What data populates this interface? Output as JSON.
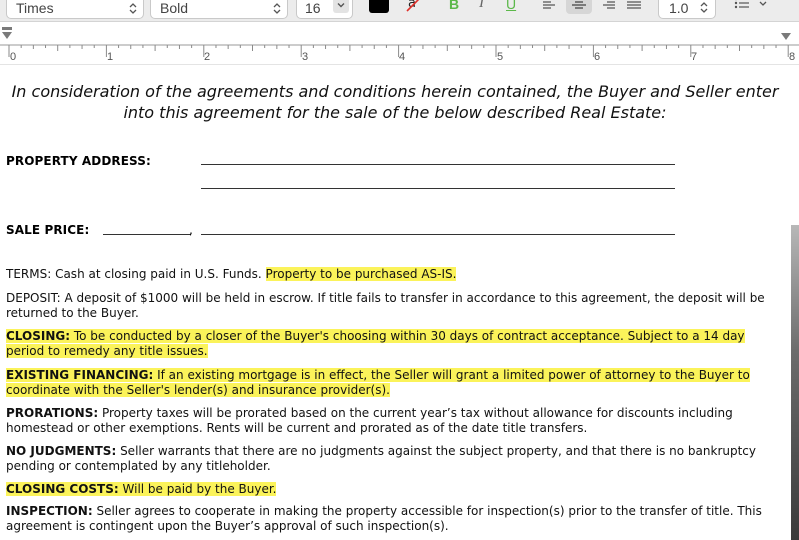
{
  "toolbar": {
    "font_family": "Times",
    "font_weight": "Bold",
    "font_size": "16",
    "text_color": "#000000",
    "bold_glyph": "B",
    "italic_glyph": "I",
    "underline_glyph": "U",
    "line_spacing": "1.0"
  },
  "ruler": {
    "numbers": [
      "0",
      "1",
      "2",
      "3",
      "4",
      "5",
      "6",
      "7",
      "8"
    ]
  },
  "document": {
    "intro": "In consideration of the agreements and conditions herein contained, the Buyer and Seller enter into this agreement for the sale of the below described Real Estate:",
    "property_address_label": "PROPERTY ADDRESS:",
    "sale_price_label": "SALE PRICE:",
    "sale_price_comma": ",",
    "terms": {
      "text": "TERMS: Cash at closing paid in U.S. Funds. ",
      "highlight": "Property to be purchased AS-IS."
    },
    "deposit": "DEPOSIT: A deposit of $1000 will be held in escrow. If title fails to transfer in accordance to this agreement, the deposit will be returned to the Buyer.",
    "closing": {
      "heading": "CLOSING:",
      "text": " To be conducted by a closer of the Buyer's choosing within 30 days of contract acceptance. Subject to a 14 day period to remedy any title issues."
    },
    "existing_financing": {
      "heading": "EXISTING FINANCING:",
      "text": " If an existing mortgage is in effect, the Seller will grant a limited power of attorney to the Buyer to coordinate with the Seller's lender(s) and insurance provider(s)."
    },
    "prorations": {
      "heading": "PRORATIONS:",
      "text": " Property taxes will be prorated based on the current year’s tax without allowance for discounts including homestead or other exemptions. Rents will be current and prorated as of the date title transfers."
    },
    "no_judgments": {
      "heading": "NO JUDGMENTS:",
      "text": " Seller warrants that there are no judgments against the subject property, and that there is no bankruptcy pending or contemplated by any titleholder."
    },
    "closing_costs": {
      "heading": "CLOSING COSTS:",
      "text": " Will be paid by the Buyer."
    },
    "inspection": {
      "heading": "INSPECTION:",
      "text": " Seller agrees to cooperate in making the property accessible for inspection(s) prior to the transfer of title. This agreement is contingent upon the Buyer’s approval of such inspection(s)."
    },
    "highlight_color": "#fbf35a"
  }
}
